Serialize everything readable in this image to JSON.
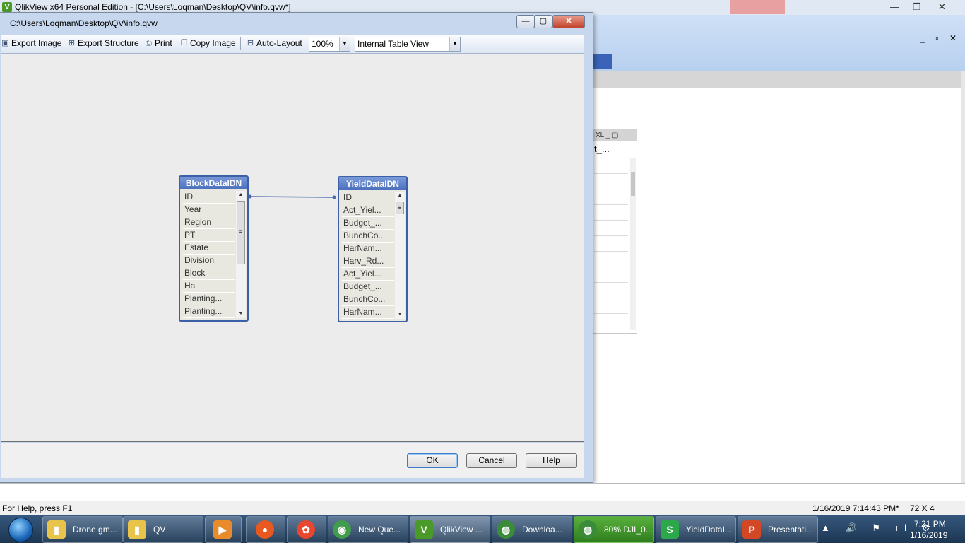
{
  "app": {
    "title": "QlikView x64 Personal Edition - [C:\\Users\\Loqman\\Desktop\\QV\\info.qvw*]",
    "logo_letter": "V",
    "mdi_buttons": "_ ▫ ✕",
    "title_buttons": [
      "—",
      "❐",
      "✕"
    ]
  },
  "sheet_object": {
    "caption": "XL _ ▢",
    "header_cell": "t_..."
  },
  "dialog": {
    "title": "C:\\Users\\Loqman\\Desktop\\QV\\info.qvw",
    "min_glyph": "—",
    "max_glyph": "▢",
    "close_glyph": "✕",
    "toolbar": {
      "export_image": "Export Image",
      "export_structure": "Export Structure",
      "print": "Print",
      "copy_image": "Copy Image",
      "auto_layout": "Auto-Layout",
      "zoom": "100%",
      "view": "Internal Table View"
    },
    "tables": [
      {
        "name": "BlockDataIDN",
        "fields": [
          "ID",
          "Year",
          "Region",
          "PT",
          "Estate",
          "Division",
          "Block",
          "Ha",
          "Planting...",
          "Planting..."
        ]
      },
      {
        "name": "YieldDataIDN",
        "fields": [
          "ID",
          "Act_Yiel...",
          "Budget_...",
          "BunchCo...",
          "HarNam...",
          "Harv_Rd...",
          "Act_Yiel...",
          "Budget_...",
          "BunchCo...",
          "HarNam..."
        ]
      }
    ],
    "buttons": {
      "ok": "OK",
      "cancel": "Cancel",
      "help": "Help"
    }
  },
  "statusbar": {
    "help": "For Help, press F1",
    "timestamp": "1/16/2019 7:14:43 PM*",
    "size": "72 X 4"
  },
  "taskbar": {
    "items": [
      {
        "label": "Drone gm...",
        "icon": "folder-icon",
        "color": "#e8c44a"
      },
      {
        "label": "QV",
        "icon": "folder-icon",
        "color": "#e8c44a"
      },
      {
        "label": "",
        "icon": "media-player-icon",
        "color": "#e98b2a"
      },
      {
        "label": "",
        "icon": "firefox-icon",
        "color": "#e8581f"
      },
      {
        "label": "",
        "icon": "pdf-reader-icon",
        "color": "#e8462e"
      },
      {
        "label": "New Que...",
        "icon": "chrome-icon",
        "color": "#3f9d4b"
      },
      {
        "label": "QlikView ...",
        "icon": "qlikview-icon",
        "color": "#4a9a2a"
      },
      {
        "label": "Downloa...",
        "icon": "download-manager-icon",
        "color": "#3a8b3a"
      },
      {
        "label": "80% DJI_0...",
        "icon": "download-manager-icon",
        "color": "#3a8b3a"
      },
      {
        "label": "YieldDataI...",
        "icon": "spreadsheet-icon",
        "color": "#2ca84a"
      },
      {
        "label": "Presentati...",
        "icon": "powerpoint-icon",
        "color": "#d24726"
      }
    ],
    "clock_time": "7:21 PM",
    "clock_date": "1/16/2019",
    "tray_icons": "▲ 🔊 ⚑ ıl ⚙"
  }
}
